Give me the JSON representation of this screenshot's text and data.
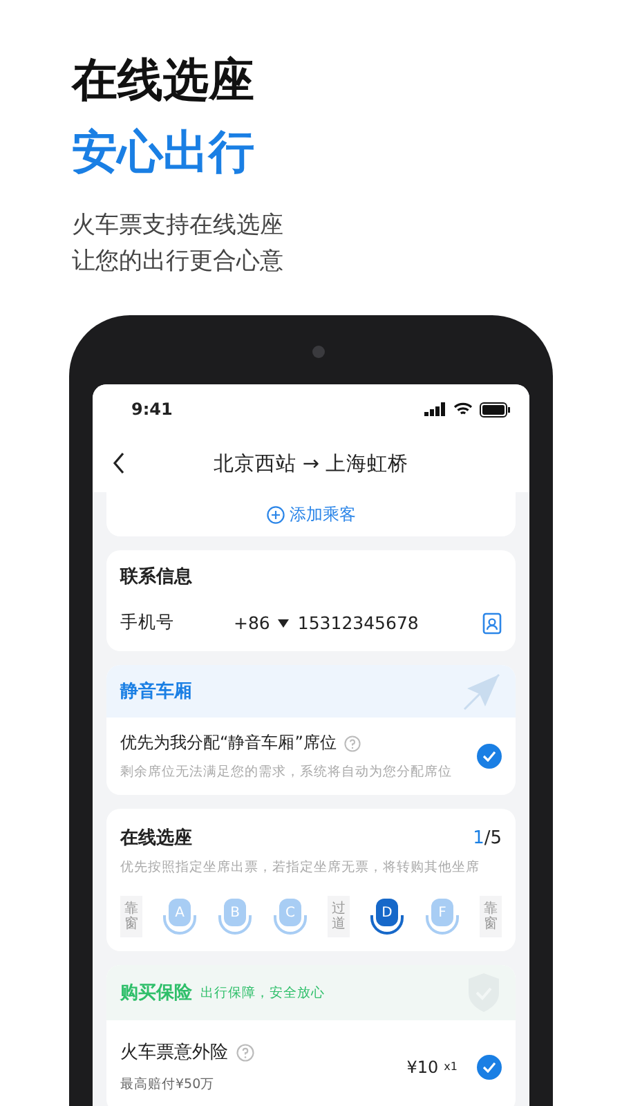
{
  "headline": {
    "title": "在线选座",
    "subtitle": "安心出行",
    "lines": [
      "火车票支持在线选座",
      "让您的出行更合心意"
    ]
  },
  "status_bar": {
    "time": "9:41"
  },
  "nav": {
    "title": "北京西站 → 上海虹桥"
  },
  "add_passenger": {
    "label": "添加乘客"
  },
  "contact": {
    "title": "联系信息",
    "label": "手机号",
    "country_code": "+86",
    "phone": "15312345678"
  },
  "quiet_car": {
    "title": "静音车厢",
    "option": "优先为我分配“静音车厢”席位",
    "note": "剩余席位无法满足您的需求，系统将自动为您分配席位",
    "checked": true
  },
  "seat_selection": {
    "title": "在线选座",
    "count_selected": "1",
    "count_total": "/5",
    "note": "优先按照指定坐席出票，若指定坐席无票，将转购其他坐席",
    "seats": [
      {
        "kind": "label",
        "text": "靠窗"
      },
      {
        "kind": "seat",
        "letter": "A",
        "selected": false
      },
      {
        "kind": "seat",
        "letter": "B",
        "selected": false
      },
      {
        "kind": "seat",
        "letter": "C",
        "selected": false
      },
      {
        "kind": "label",
        "text": "过道"
      },
      {
        "kind": "seat",
        "letter": "D",
        "selected": true
      },
      {
        "kind": "seat",
        "letter": "F",
        "selected": false
      },
      {
        "kind": "label",
        "text": "靠窗"
      }
    ]
  },
  "insurance": {
    "title": "购买保险",
    "tagline": "出行保障，安全放心",
    "item": "火车票意外险",
    "coverage": "最高赔付¥50万",
    "price": "¥10",
    "quantity": "x1",
    "checked": true
  }
}
